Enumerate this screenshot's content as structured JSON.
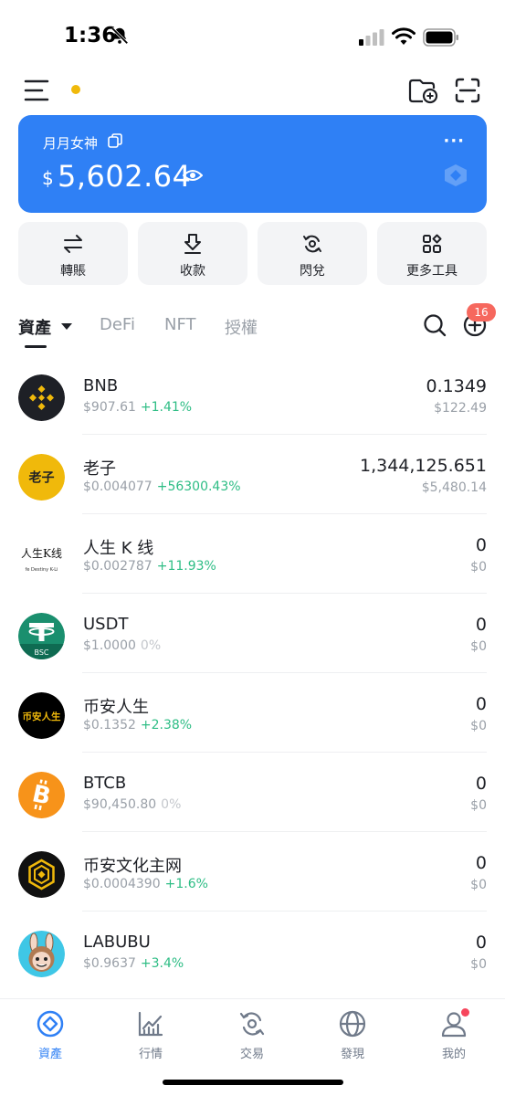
{
  "status_bar": {
    "time": "1:36"
  },
  "card": {
    "wallet_name": "月月女神",
    "currency": "$",
    "balance": "5,602.64",
    "color": "#2f80f5"
  },
  "actions": [
    {
      "label": "轉賬",
      "icon": "transfer-icon"
    },
    {
      "label": "收款",
      "icon": "receive-icon"
    },
    {
      "label": "閃兌",
      "icon": "swap-icon"
    },
    {
      "label": "更多工具",
      "icon": "grid-icon"
    }
  ],
  "tabs": [
    {
      "label": "資產",
      "active": true
    },
    {
      "label": "DeFi"
    },
    {
      "label": "NFT"
    },
    {
      "label": "授權"
    }
  ],
  "notification_badge": "16",
  "assets": [
    {
      "name": "BNB",
      "price": "$907.61",
      "change": "+1.41%",
      "amount": "0.1349",
      "value": "$122.49",
      "icon": "bnb-icon"
    },
    {
      "name": "老子",
      "price": "$0.004077",
      "change": "+56300.43%",
      "amount": "1,344,125.651",
      "value": "$5,480.14",
      "icon": "laozi-icon",
      "icon_text": "老子"
    },
    {
      "name": "人生 K 线",
      "price": "$0.002787",
      "change": "+11.93%",
      "amount": "0",
      "value": "$0",
      "icon": "life-k-line-icon",
      "icon_text": "人生K线",
      "icon_subtext": "fe Destiny K-Li"
    },
    {
      "name": "USDT",
      "price": "$1.0000",
      "change": "0%",
      "amount": "0",
      "value": "$0",
      "icon": "usdt-icon",
      "icon_text": "BSC"
    },
    {
      "name": "币安人生",
      "price": "$0.1352",
      "change": "+2.38%",
      "amount": "0",
      "value": "$0",
      "icon": "binance-life-icon",
      "icon_text": "币安人生"
    },
    {
      "name": "BTCB",
      "price": "$90,450.80",
      "change": "0%",
      "amount": "0",
      "value": "$0",
      "icon": "btcb-icon"
    },
    {
      "name": "币安文化主网",
      "price": "$0.0004390",
      "change": "+1.6%",
      "amount": "0",
      "value": "$0",
      "icon": "binance-culture-icon"
    },
    {
      "name": "LABUBU",
      "price": "$0.9637",
      "change": "+3.4%",
      "amount": "0",
      "value": "$0",
      "icon": "labubu-icon"
    }
  ],
  "bottom_nav": [
    {
      "label": "資產",
      "active": true,
      "icon": "assets-icon"
    },
    {
      "label": "行情",
      "icon": "market-icon"
    },
    {
      "label": "交易",
      "icon": "trade-icon"
    },
    {
      "label": "發現",
      "icon": "discover-icon"
    },
    {
      "label": "我的",
      "icon": "profile-icon"
    }
  ],
  "colors": {
    "accent": "#2f80f5",
    "up": "#2ebd85",
    "badge": "#f6685e",
    "bnb": "#f0b90b"
  }
}
